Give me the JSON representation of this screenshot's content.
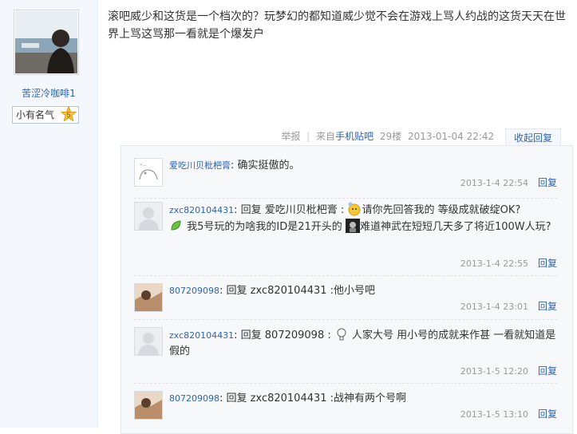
{
  "author": {
    "username": "苦涩冷咖啡1",
    "rank_label": "小有名气",
    "rank_level": "5"
  },
  "post": {
    "content": "滚吧威少和这货是一个档次的？玩梦幻的都知道威少觉不会在游戏上骂人约战的这货天天在世界上骂这骂那一看就是个爆发户"
  },
  "post_meta": {
    "report": "举报",
    "sep": "|",
    "from": "来自",
    "source": "手机贴吧",
    "floor": "29楼",
    "time": "2013-01-04 22:42",
    "collapse": "收起回复"
  },
  "replies": [
    {
      "name": "爱吃川贝枇杷膏",
      "colon": ":",
      "text": "确实挺傲的。",
      "time": "2013-1-4 22:54",
      "reply": "回复"
    },
    {
      "name": "zxc820104431",
      "colon": ":",
      "text_a": "回复 爱吃川贝枇杷膏 :",
      "text_b": "请你先回答我的 等级成就破绽OK?",
      "text_c": "我5号玩的为啥我的ID是21开头的",
      "text_d": "难道神武在短短几天多了将近100W人玩?",
      "time": "2013-1-4 22:55",
      "reply": "回复"
    },
    {
      "name": "807209098",
      "colon": ":",
      "text": "回复 zxc820104431 :他小号吧",
      "time": "2013-1-4 23:01",
      "reply": "回复"
    },
    {
      "name": "zxc820104431",
      "colon": ":",
      "text_a": "回复 807209098 :",
      "text_b": "人家大号 用小号的成就来作甚 一看就知道是假的",
      "time": "2013-1-5 12:20",
      "reply": "回复"
    },
    {
      "name": "807209098",
      "colon": ":",
      "text": "回复 zxc820104431 :战神有两个号啊",
      "time": "2013-1-5 13:10",
      "reply": "回复"
    }
  ]
}
